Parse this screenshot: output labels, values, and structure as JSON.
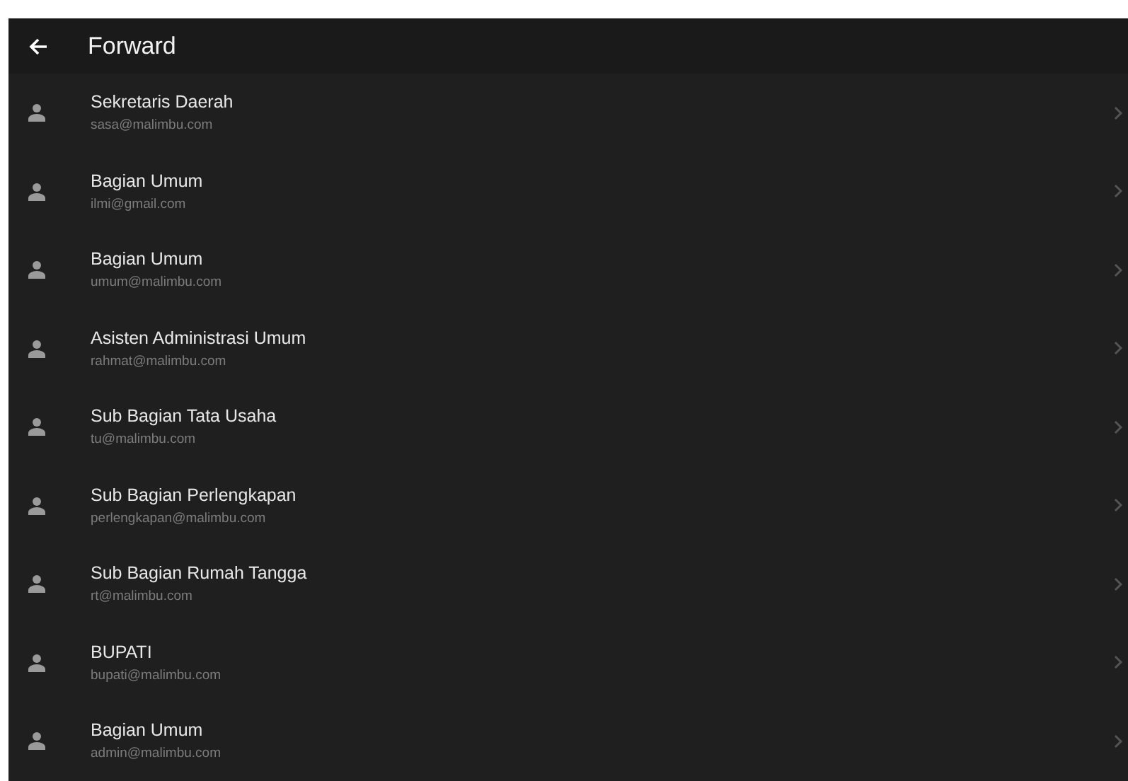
{
  "header": {
    "title": "Forward"
  },
  "contacts": [
    {
      "name": "Sekretaris Daerah",
      "email": "sasa@malimbu.com"
    },
    {
      "name": "Bagian Umum",
      "email": "ilmi@gmail.com"
    },
    {
      "name": "Bagian Umum",
      "email": "umum@malimbu.com"
    },
    {
      "name": "Asisten Administrasi Umum",
      "email": "rahmat@malimbu.com"
    },
    {
      "name": "Sub Bagian Tata Usaha",
      "email": "tu@malimbu.com"
    },
    {
      "name": "Sub Bagian Perlengkapan",
      "email": "perlengkapan@malimbu.com"
    },
    {
      "name": "Sub Bagian Rumah Tangga",
      "email": "rt@malimbu.com"
    },
    {
      "name": "BUPATI",
      "email": "bupati@malimbu.com"
    },
    {
      "name": "Bagian Umum",
      "email": "admin@malimbu.com"
    }
  ]
}
